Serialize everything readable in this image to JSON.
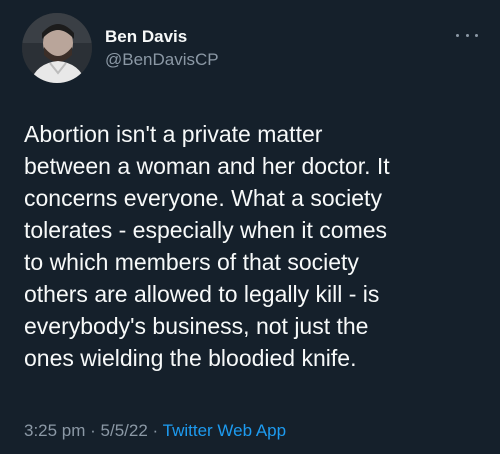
{
  "author": {
    "display_name": "Ben Davis",
    "handle": "@BenDavisCP"
  },
  "tweet": {
    "text": "Abortion isn't a private matter\nbetween a woman and her doctor. It\nconcerns everyone. What a society\ntolerates - especially when it comes\nto which members of that society\nothers are allowed to legally kill - is\neverybody's business, not just the\nones wielding the bloodied knife.",
    "time": "3:25 pm",
    "separator": " · ",
    "date": "5/5/22",
    "source": "Twitter Web App"
  },
  "icons": {
    "more": "more-horizontal-icon"
  },
  "colors": {
    "background": "#15202b",
    "text": "#f7f9f9",
    "secondary": "#8b98a5",
    "accent": "#1d9bf0"
  }
}
